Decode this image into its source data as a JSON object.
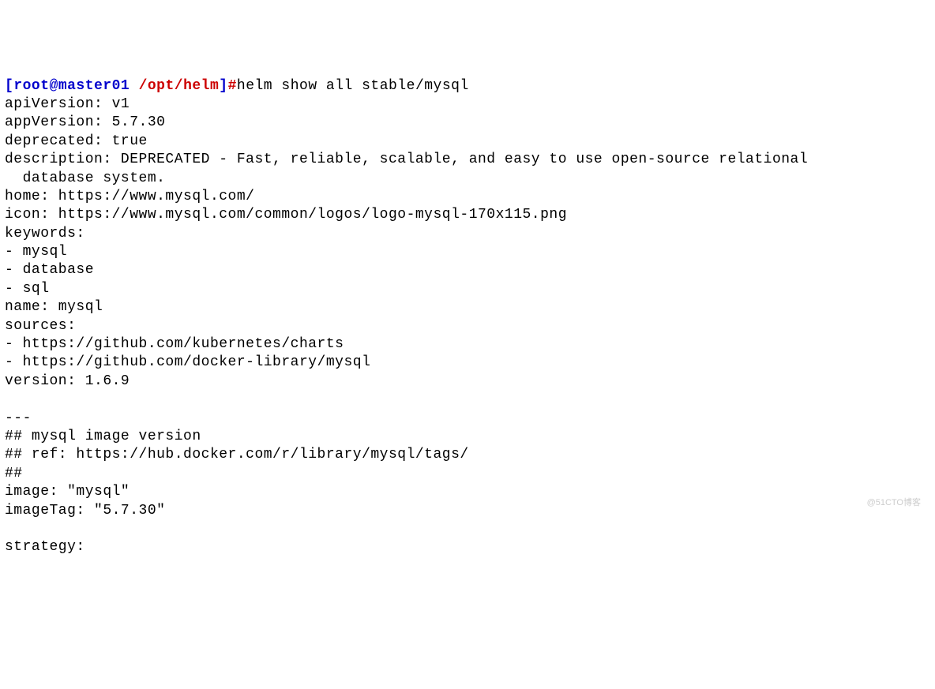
{
  "prompt": {
    "bracket_open": "[",
    "user_host": "root@master01",
    "separator": " ",
    "path": "/opt/helm",
    "bracket_close": "]",
    "hash": "#"
  },
  "command": "helm show all stable/mysql",
  "output_lines": [
    "apiVersion: v1",
    "appVersion: 5.7.30",
    "deprecated: true",
    "description: DEPRECATED - Fast, reliable, scalable, and easy to use open-source relational",
    "  database system.",
    "home: https://www.mysql.com/",
    "icon: https://www.mysql.com/common/logos/logo-mysql-170x115.png",
    "keywords:",
    "- mysql",
    "- database",
    "- sql",
    "name: mysql",
    "sources:",
    "- https://github.com/kubernetes/charts",
    "- https://github.com/docker-library/mysql",
    "version: 1.6.9",
    "",
    "---",
    "## mysql image version",
    "## ref: https://hub.docker.com/r/library/mysql/tags/",
    "##",
    "image: \"mysql\"",
    "imageTag: \"5.7.30\"",
    "",
    "strategy:"
  ],
  "watermark": "@51CTO博客"
}
